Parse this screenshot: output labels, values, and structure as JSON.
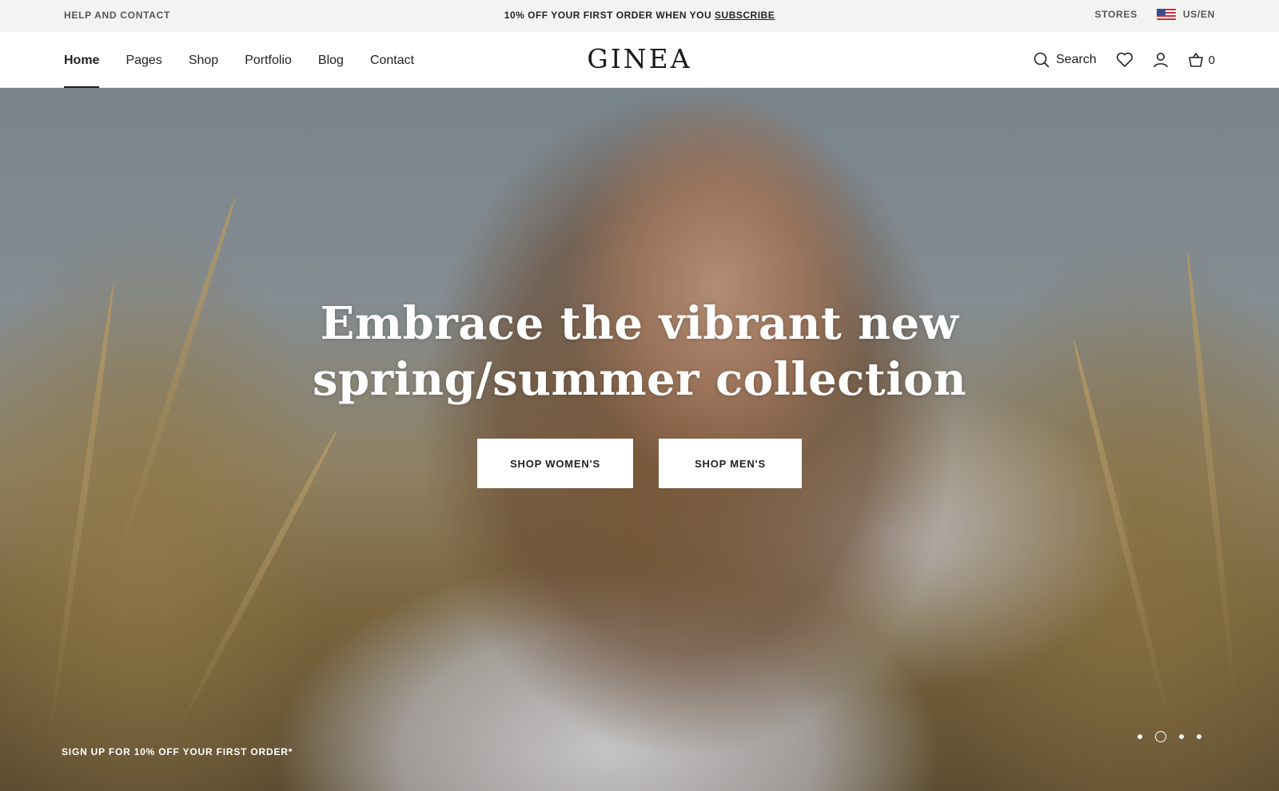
{
  "topbar": {
    "help": "HELP AND CONTACT",
    "promo_text": "10% OFF YOUR FIRST ORDER WHEN YOU ",
    "promo_link": "SUBSCRIBE",
    "stores": "STORES",
    "locale": "US/EN"
  },
  "header": {
    "logo": "GINEA",
    "nav": [
      "Home",
      "Pages",
      "Shop",
      "Portfolio",
      "Blog",
      "Contact"
    ],
    "active_nav": "Home",
    "search_label": "Search",
    "cart_count": "0"
  },
  "hero": {
    "headline_line1": "Embrace the vibrant new",
    "headline_line2": "spring/summer collection",
    "cta_women": "SHOP WOMEN'S",
    "cta_men": "SHOP MEN'S",
    "signup": "SIGN UP FOR 10% OFF YOUR FIRST ORDER*",
    "slides_total": 4,
    "active_slide": 2
  },
  "colors": {
    "topbar_bg": "#f3f3f2",
    "text": "#222222",
    "button_bg": "#ffffff"
  },
  "icons": [
    "search-icon",
    "heart-icon",
    "user-icon",
    "cart-icon",
    "us-flag-icon"
  ]
}
